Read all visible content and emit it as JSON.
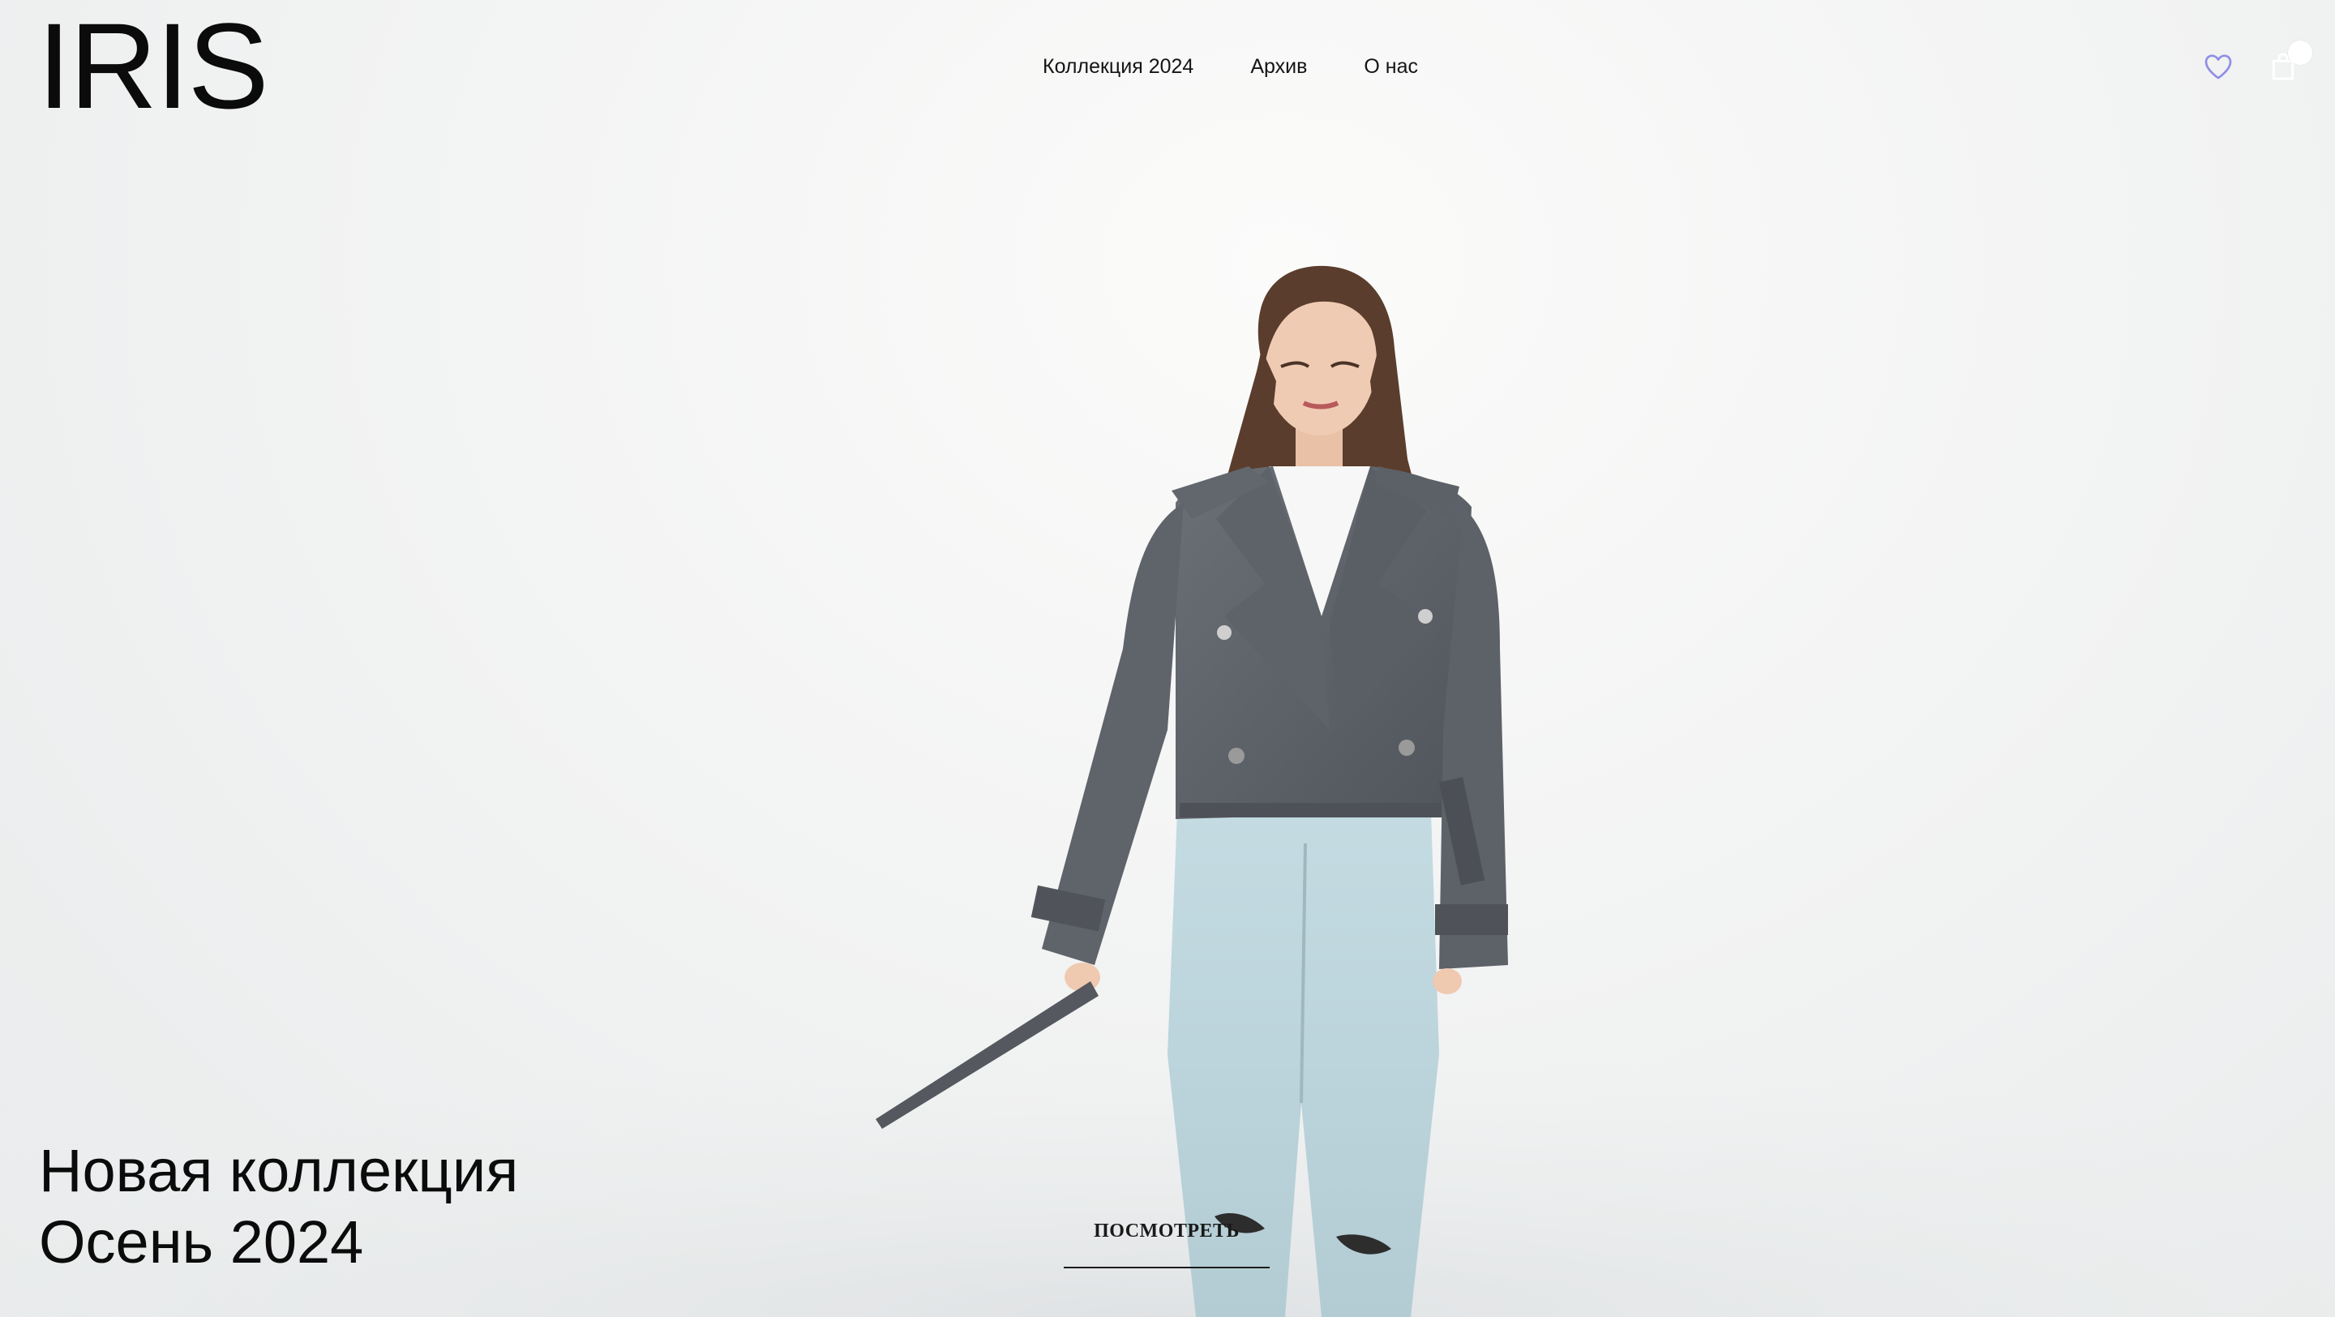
{
  "header": {
    "logo": "IRIS",
    "nav": [
      {
        "label": "Коллекция 2024"
      },
      {
        "label": "Архив"
      },
      {
        "label": "О нас"
      }
    ],
    "icons": {
      "wishlist": "heart-icon",
      "cart": "shopping-bag-icon"
    },
    "accent_color": "#8f8ee6"
  },
  "hero": {
    "title_line1": "Новая коллекция",
    "title_line2": "Осень 2024",
    "cta_label": "ПОСМОТРЕТЬ"
  }
}
